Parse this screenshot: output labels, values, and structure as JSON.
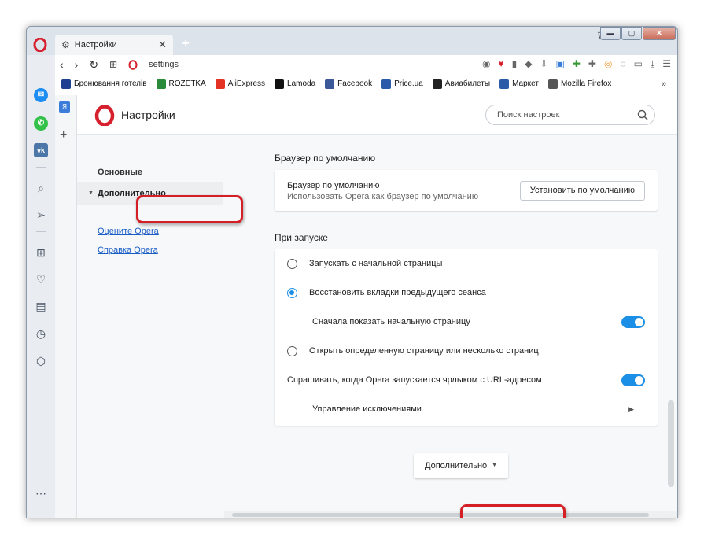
{
  "tab": {
    "title": "Настройки"
  },
  "address": {
    "url": "settings"
  },
  "bookmarks": [
    {
      "label": "Бронювання готелів",
      "icon": "booking-icon",
      "color": "#1e3f8f"
    },
    {
      "label": "ROZETKA",
      "icon": "rozetka-icon",
      "color": "#2a8c3b"
    },
    {
      "label": "AliExpress",
      "icon": "aliexpress-icon",
      "color": "#e43225"
    },
    {
      "label": "Lamoda",
      "icon": "lamoda-icon",
      "color": "#111111"
    },
    {
      "label": "Facebook",
      "icon": "facebook-icon",
      "color": "#3b5998"
    },
    {
      "label": "Price.ua",
      "icon": "priceua-icon",
      "color": "#2a5aa8"
    },
    {
      "label": "Авиабилеты",
      "icon": "plane-icon",
      "color": "#222222"
    },
    {
      "label": "Маркет",
      "icon": "cart-icon",
      "color": "#2a5aa8"
    },
    {
      "label": "Mozilla Firefox",
      "icon": "folder-icon",
      "color": "#555555"
    }
  ],
  "settings": {
    "title": "Настройки",
    "search_placeholder": "Поиск настроек"
  },
  "nav": {
    "basic": "Основные",
    "advanced": "Дополнительно",
    "rate_link": "Оцените Opera",
    "help_link": "Справка Opera"
  },
  "default_browser": {
    "section": "Браузер по умолчанию",
    "title": "Браузер по умолчанию",
    "desc": "Использовать Opera как браузер по умолчанию",
    "button": "Установить по умолчанию"
  },
  "startup": {
    "section": "При запуске",
    "opt1": "Запускать с начальной страницы",
    "opt2": "Восстановить вкладки предыдущего сеанса",
    "sub_opt": "Сначала показать начальную страницу",
    "opt3": "Открыть определенную страницу или несколько страниц",
    "ask_shortcut": "Спрашивать, когда Opera запускается ярлыком с URL-адресом",
    "manage_exceptions": "Управление исключениями"
  },
  "advanced_button": "Дополнительно",
  "colors": {
    "accent": "#1b8ee6",
    "opera_red": "#d6202d",
    "highlight": "#d41f26"
  }
}
